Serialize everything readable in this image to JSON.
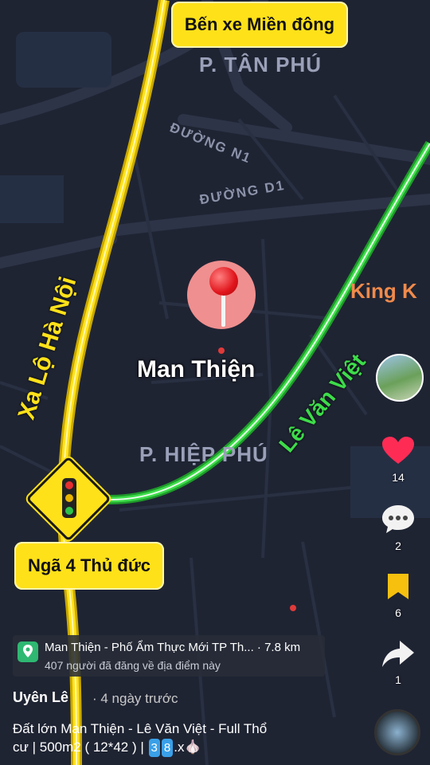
{
  "map": {
    "callout_top": "Bến xe Miền đông",
    "callout_bottom": "Ngã 4 Thủ đức",
    "area_tan_phu": "P. TÂN PHÚ",
    "area_hiep_phu": "P. HIỆP PHÚ",
    "street_n1": "ĐƯỜNG N1",
    "street_d1": "ĐƯỜNG D1",
    "poi_king": "King K",
    "road_yellow": "Xa Lộ Hà Nội",
    "road_green": "Lê Văn Việt",
    "place": "Man Thiện"
  },
  "side_rail": {
    "likes": "14",
    "comments": "2",
    "saves": "6",
    "shares": "1"
  },
  "location_chip": {
    "title": "Man Thiện - Phố Ẩm Thực Mới TP Th... · 7.8 km",
    "subtitle": "407 người đã đăng về địa điểm này"
  },
  "post": {
    "author": "Uyên Lê",
    "time": "· 4 ngày trước",
    "caption_line1": "Đất lớn Man Thiện - Lê Văn Việt - Full Thổ",
    "caption_line2_prefix": "cư | 500m2 ( 12*42 ) |",
    "key1": "3",
    "key2": "8",
    "caption_suffix": ".x🧄"
  },
  "colors": {
    "map_bg": "#1f2433",
    "yellow_road": "#ffe11a",
    "green_road": "#3ddc4a",
    "heart": "#fe2c55",
    "bookmark": "#f7c00f"
  }
}
